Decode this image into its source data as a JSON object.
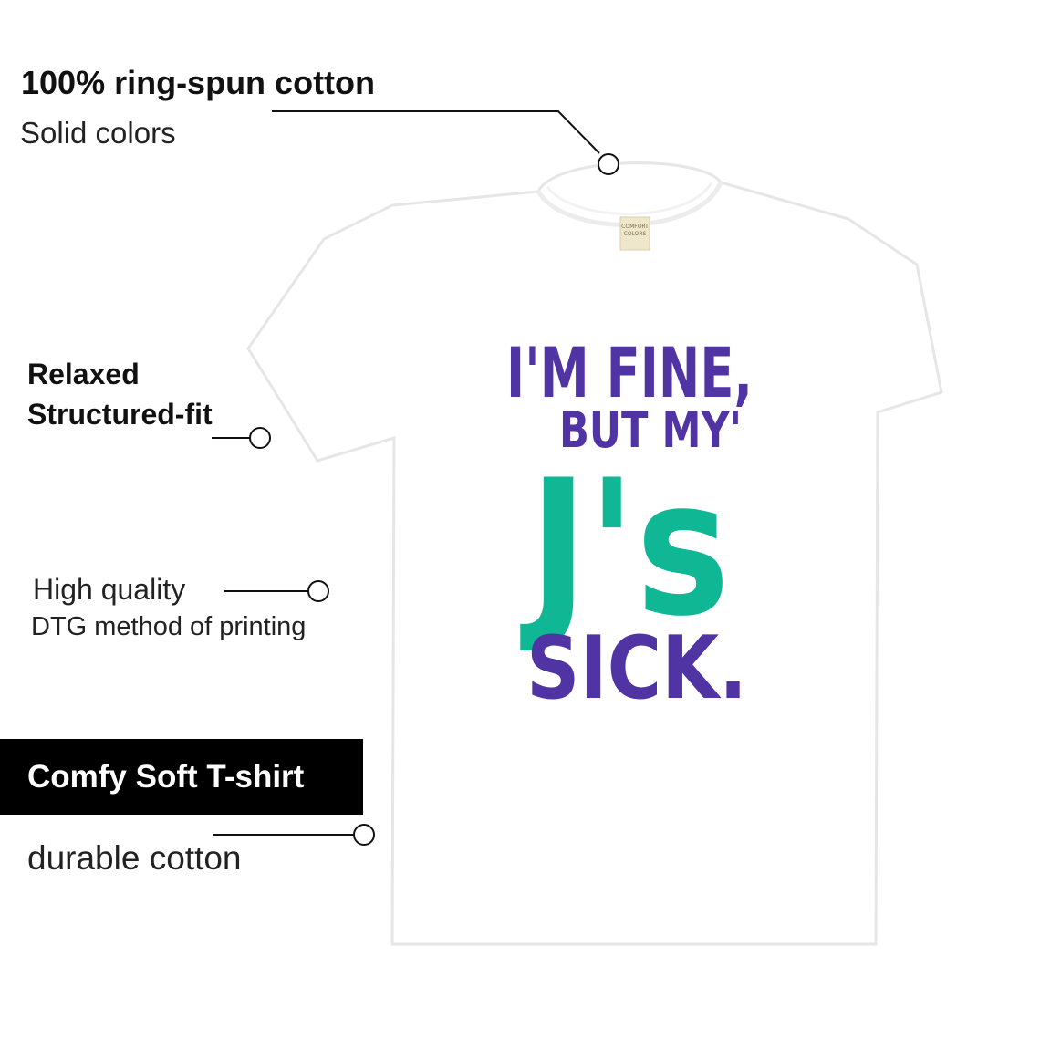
{
  "features": {
    "cotton_title": "100% ring-spun cotton",
    "cotton_sub": "Solid colors",
    "fit_line1": "Relaxed",
    "fit_line2": "Structured-fit",
    "quality_line1": "High quality",
    "quality_line2": "DTG method of printing",
    "banner": "Comfy Soft T-shirt",
    "durable": "durable cotton"
  },
  "tshirt": {
    "label_line1": "COMFORT",
    "label_line2": "COLORS",
    "slogan_line1": "I'M FINE,",
    "slogan_line2": "BUT MY'",
    "slogan_line3": "J's",
    "slogan_line4": "SICK."
  },
  "colors": {
    "purple": "#5134a3",
    "teal": "#10b794",
    "shirt": "#ffffff",
    "outline": "#e4e4e4"
  }
}
